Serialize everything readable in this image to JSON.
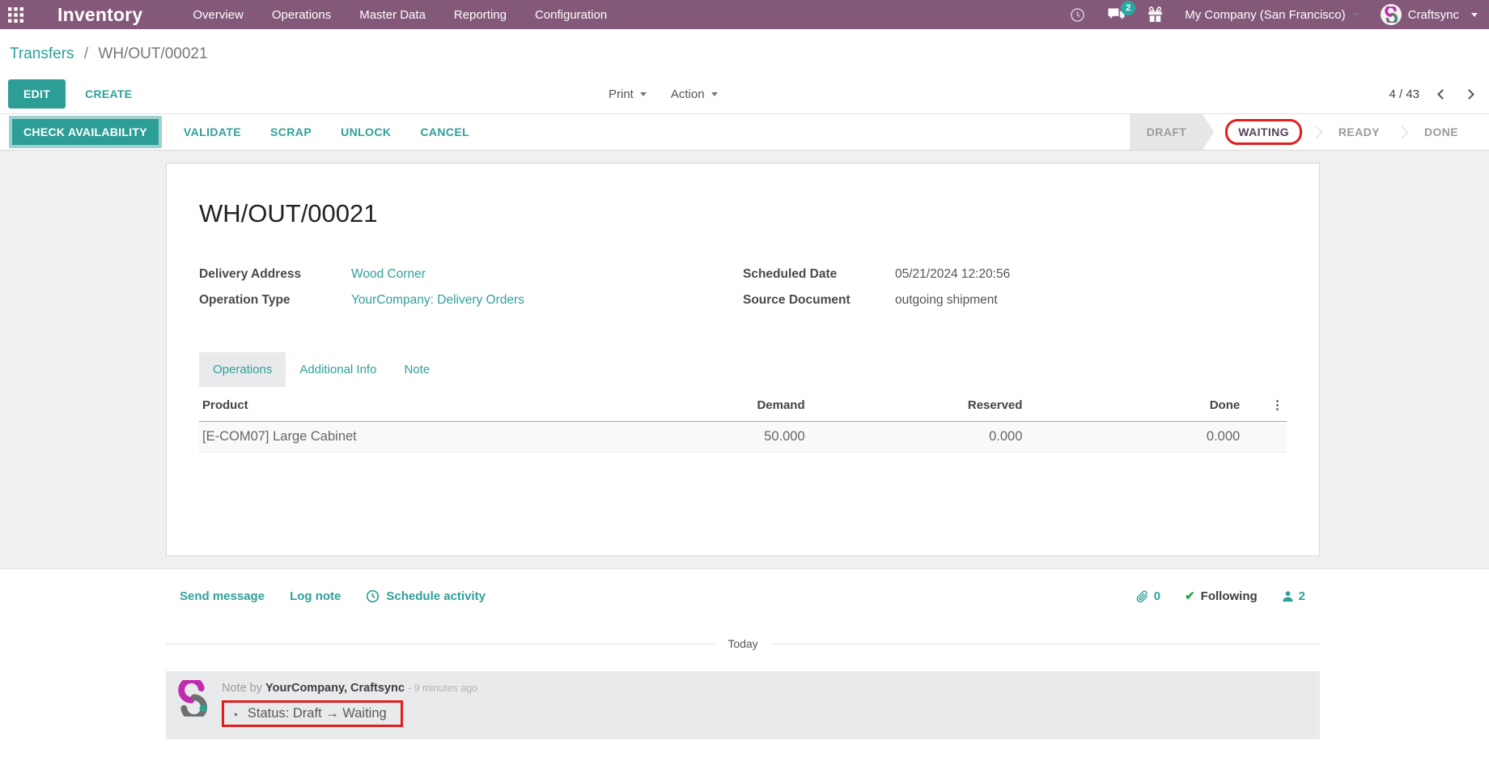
{
  "nav": {
    "app_title": "Inventory",
    "menus": [
      "Overview",
      "Operations",
      "Master Data",
      "Reporting",
      "Configuration"
    ],
    "message_badge": "2",
    "company": "My Company (San Francisco)",
    "user": "Craftsync"
  },
  "breadcrumb": {
    "parent": "Transfers",
    "separator": "/",
    "current": "WH/OUT/00021"
  },
  "control_panel": {
    "edit": "EDIT",
    "create": "CREATE",
    "print": "Print",
    "action": "Action",
    "pager": "4 / 43"
  },
  "statusbar": {
    "buttons": [
      "CHECK AVAILABILITY",
      "VALIDATE",
      "SCRAP",
      "UNLOCK",
      "CANCEL"
    ],
    "states": [
      "DRAFT",
      "WAITING",
      "READY",
      "DONE"
    ],
    "active_state": "WAITING"
  },
  "sheet": {
    "title": "WH/OUT/00021",
    "fields": {
      "delivery_address_label": "Delivery Address",
      "delivery_address_value": "Wood Corner",
      "operation_type_label": "Operation Type",
      "operation_type_value": "YourCompany: Delivery Orders",
      "scheduled_date_label": "Scheduled Date",
      "scheduled_date_value": "05/21/2024 12:20:56",
      "source_document_label": "Source Document",
      "source_document_value": "outgoing shipment"
    },
    "tabs": [
      "Operations",
      "Additional Info",
      "Note"
    ],
    "active_tab": "Operations",
    "table": {
      "headers": [
        "Product",
        "Demand",
        "Reserved",
        "Done"
      ],
      "rows": [
        {
          "product": "[E-COM07] Large Cabinet",
          "demand": "50.000",
          "reserved": "0.000",
          "done": "0.000"
        }
      ]
    }
  },
  "chatter": {
    "send_message": "Send message",
    "log_note": "Log note",
    "schedule_activity": "Schedule activity",
    "attachment_count": "0",
    "following": "Following",
    "follower_count": "2",
    "date_divider": "Today",
    "message": {
      "prefix": "Note by",
      "author": "YourCompany, Craftsync",
      "time": "- 9 minutes ago",
      "body": "Status: Draft → Waiting"
    }
  },
  "icons": {
    "kebab": "⋮",
    "bullet": "•",
    "check": "✔"
  },
  "colors": {
    "accent": "#2fa09a",
    "nav_bg": "#835879",
    "annotation": "#e01e1e",
    "active_state_text": "#564459"
  }
}
